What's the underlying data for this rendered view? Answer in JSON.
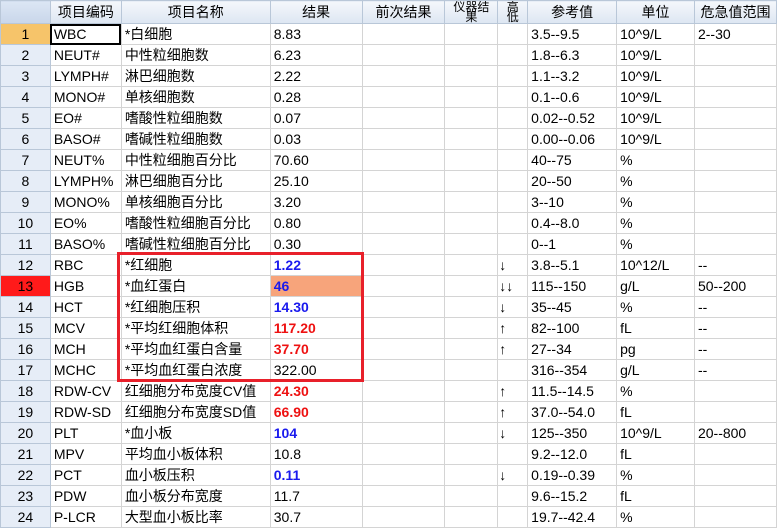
{
  "headers": [
    "项目编码",
    "项目名称",
    "结果",
    "前次结果",
    "仪器结果",
    "高低",
    "参考值",
    "单位",
    "危急值范围"
  ],
  "rows": [
    {
      "n": "1",
      "code": "WBC",
      "name": "*白细胞",
      "result": "8.83",
      "flag": "",
      "ref": "3.5--9.5",
      "unit": "10^9/L",
      "crit": "2--30"
    },
    {
      "n": "2",
      "code": "NEUT#",
      "name": "中性粒细胞数",
      "result": "6.23",
      "flag": "",
      "ref": "1.8--6.3",
      "unit": "10^9/L",
      "crit": ""
    },
    {
      "n": "3",
      "code": "LYMPH#",
      "name": "淋巴细胞数",
      "result": "2.22",
      "flag": "",
      "ref": "1.1--3.2",
      "unit": "10^9/L",
      "crit": ""
    },
    {
      "n": "4",
      "code": "MONO#",
      "name": "单核细胞数",
      "result": "0.28",
      "flag": "",
      "ref": "0.1--0.6",
      "unit": "10^9/L",
      "crit": ""
    },
    {
      "n": "5",
      "code": "EO#",
      "name": "嗜酸性粒细胞数",
      "result": "0.07",
      "flag": "",
      "ref": "0.02--0.52",
      "unit": "10^9/L",
      "crit": ""
    },
    {
      "n": "6",
      "code": "BASO#",
      "name": "嗜碱性粒细胞数",
      "result": "0.03",
      "flag": "",
      "ref": "0.00--0.06",
      "unit": "10^9/L",
      "crit": ""
    },
    {
      "n": "7",
      "code": "NEUT%",
      "name": "中性粒细胞百分比",
      "result": "70.60",
      "flag": "",
      "ref": "40--75",
      "unit": "%",
      "crit": ""
    },
    {
      "n": "8",
      "code": "LYMPH%",
      "name": "淋巴细胞百分比",
      "result": "25.10",
      "flag": "",
      "ref": "20--50",
      "unit": "%",
      "crit": ""
    },
    {
      "n": "9",
      "code": "MONO%",
      "name": "单核细胞百分比",
      "result": "3.20",
      "flag": "",
      "ref": "3--10",
      "unit": "%",
      "crit": ""
    },
    {
      "n": "10",
      "code": "EO%",
      "name": "嗜酸性粒细胞百分比",
      "result": "0.80",
      "flag": "",
      "ref": "0.4--8.0",
      "unit": "%",
      "crit": ""
    },
    {
      "n": "11",
      "code": "BASO%",
      "name": "嗜碱性粒细胞百分比",
      "result": "0.30",
      "flag": "",
      "ref": "0--1",
      "unit": "%",
      "crit": ""
    },
    {
      "n": "12",
      "code": "RBC",
      "name": "*红细胞",
      "result": "1.22",
      "flag": "↓",
      "ref": "3.8--5.1",
      "unit": "10^12/L",
      "crit": "--",
      "color": "blue"
    },
    {
      "n": "13",
      "code": "HGB",
      "name": "*血红蛋白",
      "result": "46",
      "flag": "↓↓",
      "ref": "115--150",
      "unit": "g/L",
      "crit": "50--200",
      "color": "blue",
      "critical": true
    },
    {
      "n": "14",
      "code": "HCT",
      "name": "*红细胞压积",
      "result": "14.30",
      "flag": "↓",
      "ref": "35--45",
      "unit": "%",
      "crit": "--",
      "color": "blue"
    },
    {
      "n": "15",
      "code": "MCV",
      "name": "*平均红细胞体积",
      "result": "117.20",
      "flag": "↑",
      "ref": "82--100",
      "unit": "fL",
      "crit": "--",
      "color": "red"
    },
    {
      "n": "16",
      "code": "MCH",
      "name": "*平均血红蛋白含量",
      "result": "37.70",
      "flag": "↑",
      "ref": "27--34",
      "unit": "pg",
      "crit": "--",
      "color": "red"
    },
    {
      "n": "17",
      "code": "MCHC",
      "name": "*平均血红蛋白浓度",
      "result": "322.00",
      "flag": "",
      "ref": "316--354",
      "unit": "g/L",
      "crit": "--"
    },
    {
      "n": "18",
      "code": "RDW-CV",
      "name": "红细胞分布宽度CV值",
      "result": "24.30",
      "flag": "↑",
      "ref": "11.5--14.5",
      "unit": "%",
      "crit": "",
      "color": "red"
    },
    {
      "n": "19",
      "code": "RDW-SD",
      "name": "红细胞分布宽度SD值",
      "result": "66.90",
      "flag": "↑",
      "ref": "37.0--54.0",
      "unit": "fL",
      "crit": "",
      "color": "red"
    },
    {
      "n": "20",
      "code": "PLT",
      "name": "*血小板",
      "result": "104",
      "flag": "↓",
      "ref": "125--350",
      "unit": "10^9/L",
      "crit": "20--800",
      "color": "blue"
    },
    {
      "n": "21",
      "code": "MPV",
      "name": "平均血小板体积",
      "result": "10.8",
      "flag": "",
      "ref": "9.2--12.0",
      "unit": "fL",
      "crit": ""
    },
    {
      "n": "22",
      "code": "PCT",
      "name": "血小板压积",
      "result": "0.11",
      "flag": "↓",
      "ref": "0.19--0.39",
      "unit": "%",
      "crit": "",
      "color": "blue"
    },
    {
      "n": "23",
      "code": "PDW",
      "name": "血小板分布宽度",
      "result": "11.7",
      "flag": "",
      "ref": "9.6--15.2",
      "unit": "fL",
      "crit": ""
    },
    {
      "n": "24",
      "code": "P-LCR",
      "name": "大型血小板比率",
      "result": "30.7",
      "flag": "",
      "ref": "19.7--42.4",
      "unit": "%",
      "crit": ""
    }
  ]
}
